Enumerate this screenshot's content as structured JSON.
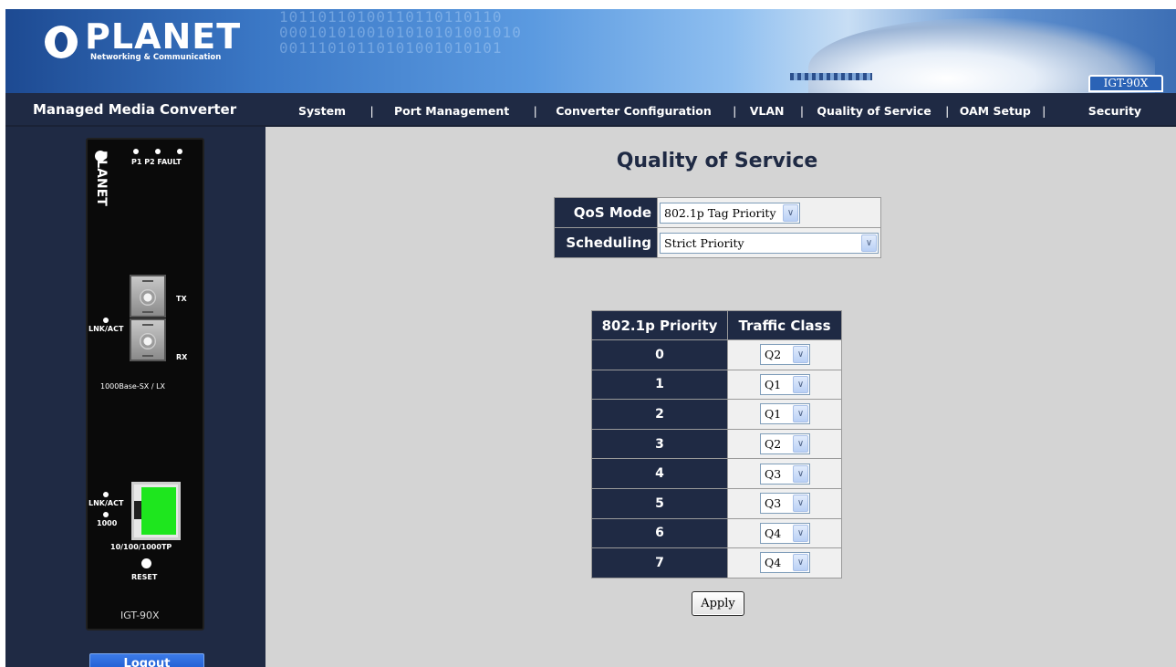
{
  "banner": {
    "logo_word": "PLANET",
    "logo_tagline": "Networking & Communication",
    "model_badge": "IGT-90X",
    "binary_decor": "10110110100110110110110\n0001010100101010101001010\n00111010110101001010101"
  },
  "navbar": {
    "brand": "Managed Media Converter",
    "menu": [
      {
        "label": "System"
      },
      {
        "label": "Port Management"
      },
      {
        "label": "Converter Configuration"
      },
      {
        "label": "VLAN"
      },
      {
        "label": "Quality of Service"
      },
      {
        "label": "OAM Setup"
      },
      {
        "label": "Security"
      }
    ],
    "separator": "|"
  },
  "device": {
    "logo_word": "PLANET",
    "led_labels": "P1  P2 FAULT",
    "tx": "TX",
    "rx": "RX",
    "lnk_act_fiber": "LNK/ACT",
    "fiber_port_label": "1000Base-SX / LX",
    "lnk_act_copper": "LNK/ACT",
    "speed_1000": "1000",
    "copper_port_label": "10/100/1000TP",
    "reset": "RESET",
    "model": "IGT-90X",
    "colors": {
      "rj45_led": "#1ee61e"
    }
  },
  "sidebar": {
    "logout_label": "Logout"
  },
  "main": {
    "title": "Quality of Service",
    "qos_mode_label": "QoS Mode",
    "qos_mode_value": "802.1p Tag Priority",
    "scheduling_label": "Scheduling",
    "scheduling_value": "Strict Priority",
    "priority_table": {
      "headers": [
        "802.1p Priority",
        "Traffic Class"
      ],
      "rows": [
        {
          "priority": "0",
          "class": "Q2"
        },
        {
          "priority": "1",
          "class": "Q1"
        },
        {
          "priority": "2",
          "class": "Q1"
        },
        {
          "priority": "3",
          "class": "Q2"
        },
        {
          "priority": "4",
          "class": "Q3"
        },
        {
          "priority": "5",
          "class": "Q3"
        },
        {
          "priority": "6",
          "class": "Q4"
        },
        {
          "priority": "7",
          "class": "Q4"
        }
      ]
    },
    "apply_label": "Apply"
  },
  "colors": {
    "navy": "#1f2a44",
    "content_bg": "#d4d4d4",
    "cell_bg": "#f0f0f0",
    "logout_blue": "#1755cc"
  },
  "icons": {
    "dropdown": "chevron-down-icon"
  }
}
